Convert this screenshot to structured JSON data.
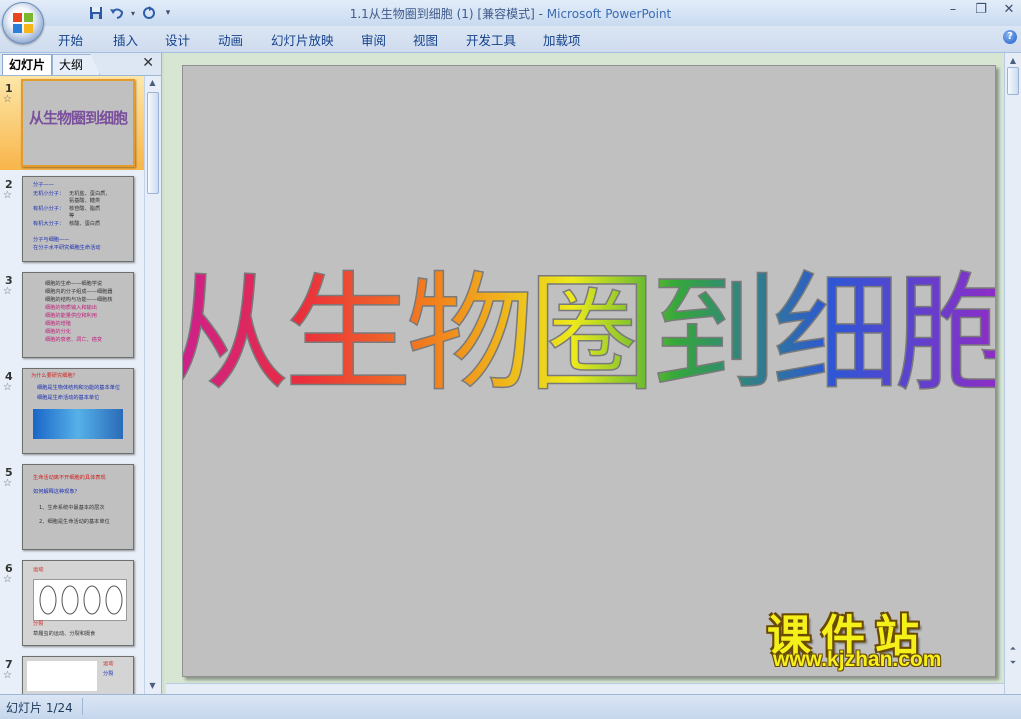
{
  "window": {
    "title_doc": "1.1从生物圈到细胞 (1) [兼容模式] - ",
    "title_app": "Microsoft PowerPoint"
  },
  "ribbon": {
    "tabs": [
      "开始",
      "插入",
      "设计",
      "动画",
      "幻灯片放映",
      "审阅",
      "视图",
      "开发工具",
      "加载项"
    ]
  },
  "left_pane": {
    "tab_slides": "幻灯片",
    "tab_outline": "大纲",
    "slides": [
      {
        "num": "1",
        "title": "从生物圈到细胞"
      },
      {
        "num": "2",
        "lines": [
          "分子——",
          "无机小分子：",
          "有机小分子：",
          "有机大分子：",
          "分子与细胞——",
          "在分子水平研究细胞生命活动"
        ],
        "side": [
          "无机盐、蛋白质、",
          "氨基酸、糖类",
          "核苷酸、脂质",
          "核酸、蛋白质",
          "等"
        ]
      },
      {
        "num": "3",
        "lines": [
          "细胞的生命——细胞学说",
          "细胞内的分子组成——细胞器",
          "细胞的结构与功能——细胞核",
          "细胞的物质输入和输出",
          "细胞的能量供应和利用",
          "细胞的增殖",
          "细胞的分化",
          "细胞的衰老、凋亡、癌变"
        ]
      },
      {
        "num": "4",
        "lines": [
          "为什么要研究细胞？",
          "细胞是生物体结构和功能的基本单位",
          "细胞是生命活动的基本单位"
        ]
      },
      {
        "num": "5",
        "lines": [
          "生命活动离不开细胞的具体表现",
          "如何解释这种现象？",
          "1、生命系统中最基本的层次",
          "2、细胞是生命活动的基本单位"
        ]
      },
      {
        "num": "6",
        "lines": [
          "运动",
          "分裂",
          "草履虫的运动、分裂和摄食"
        ]
      },
      {
        "num": "7",
        "lines": [
          "运动",
          "分裂"
        ]
      }
    ]
  },
  "slide": {
    "title": "从生物圈到细胞",
    "title_colors": [
      "#d0208a",
      "#e8342a",
      "#f08a1e",
      "#e6e61e",
      "#3fae3f",
      "#2f6fd8",
      "#9a2fc8"
    ]
  },
  "watermark": {
    "cn": "课件站",
    "url": "www.kjzhan.com"
  },
  "status": {
    "slide_counter": "幻灯片 1/24"
  }
}
